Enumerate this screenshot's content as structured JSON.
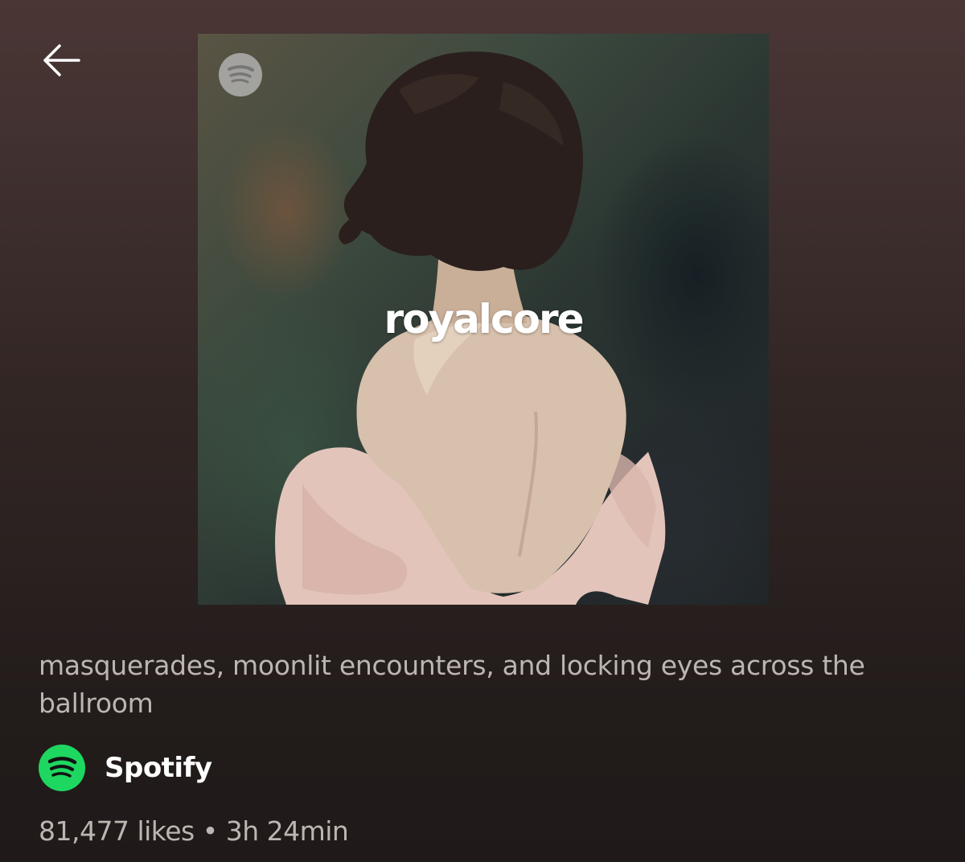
{
  "header": {
    "back_icon": "arrow-left-icon"
  },
  "playlist": {
    "cover_title": "royalcore",
    "cover_logo_icon": "spotify-logo-icon",
    "description": "masquerades, moonlit encounters, and locking eyes across the ballroom",
    "owner": {
      "name": "Spotify",
      "avatar_icon": "spotify-logo-icon",
      "avatar_color": "#1ed760"
    },
    "likes": "81,477 likes",
    "separator": "•",
    "duration": "3h 24min"
  },
  "colors": {
    "background_top": "#4a3635",
    "background_bottom": "#1f1a19",
    "secondary_text": "#bdb5b2",
    "accent": "#1ed760"
  }
}
